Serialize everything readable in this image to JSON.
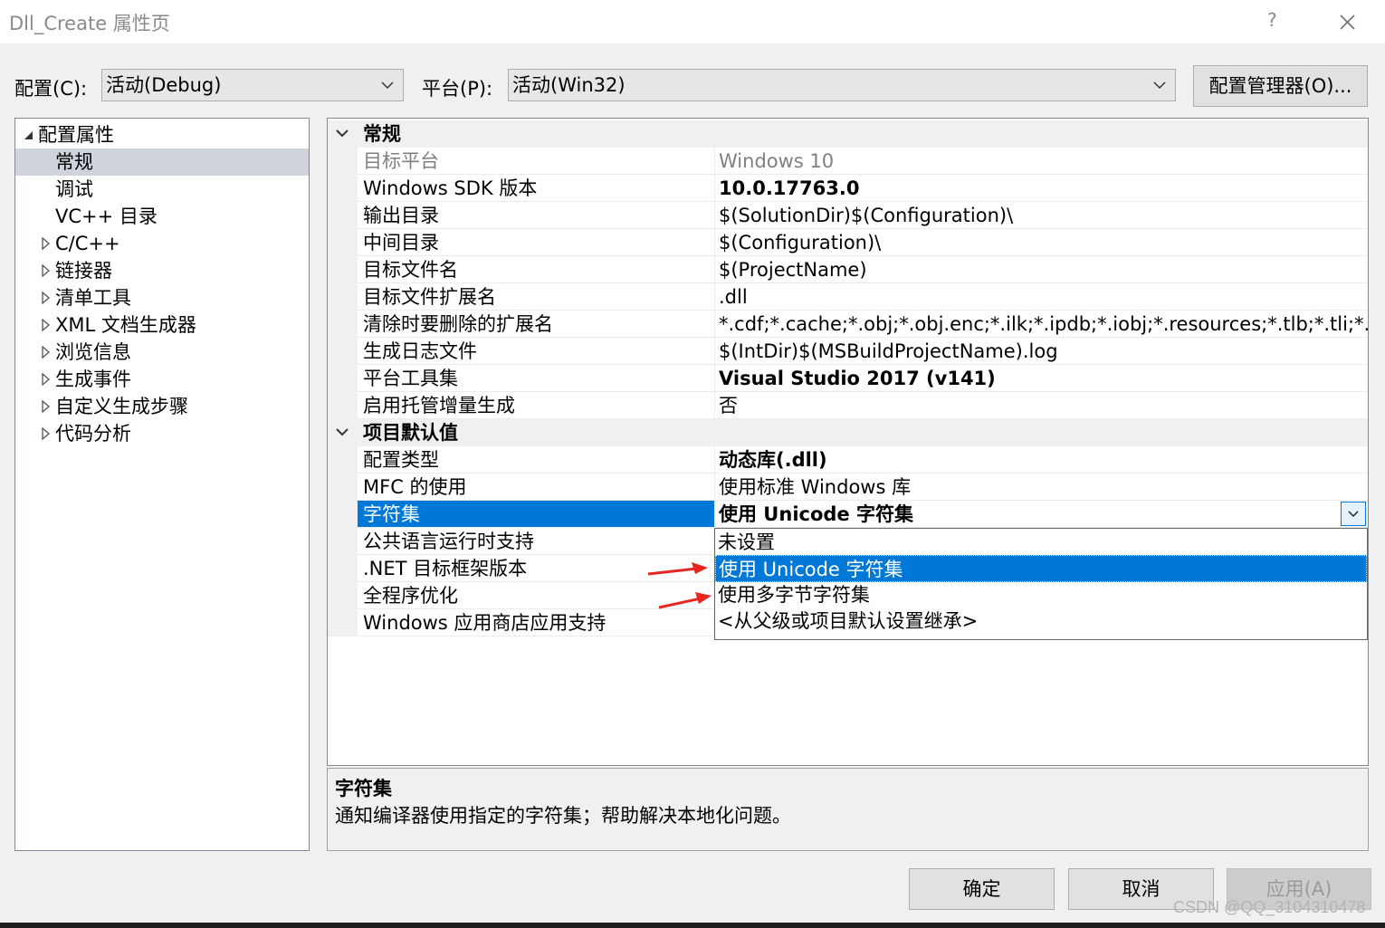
{
  "window": {
    "title": "Dll_Create 属性页",
    "help": "?"
  },
  "toolbar": {
    "config_label": "配置(C):",
    "config_value": "活动(Debug)",
    "platform_label": "平台(P):",
    "platform_value": "活动(Win32)",
    "config_manager_button": "配置管理器(O)..."
  },
  "tree": {
    "root": "配置属性",
    "items": [
      {
        "label": "常规",
        "expandable": false,
        "selected": true
      },
      {
        "label": "调试",
        "expandable": false
      },
      {
        "label": "VC++ 目录",
        "expandable": false
      },
      {
        "label": "C/C++",
        "expandable": true
      },
      {
        "label": "链接器",
        "expandable": true
      },
      {
        "label": "清单工具",
        "expandable": true
      },
      {
        "label": "XML 文档生成器",
        "expandable": true
      },
      {
        "label": "浏览信息",
        "expandable": true
      },
      {
        "label": "生成事件",
        "expandable": true
      },
      {
        "label": "自定义生成步骤",
        "expandable": true
      },
      {
        "label": "代码分析",
        "expandable": true
      }
    ]
  },
  "grid": {
    "categories": [
      {
        "label": "常规",
        "rows": [
          {
            "name": "目标平台",
            "value": "Windows 10",
            "style": "gray"
          },
          {
            "name": "Windows SDK 版本",
            "value": "10.0.17763.0",
            "style": "bold"
          },
          {
            "name": "输出目录",
            "value": "$(SolutionDir)$(Configuration)\\",
            "style": ""
          },
          {
            "name": "中间目录",
            "value": "$(Configuration)\\",
            "style": ""
          },
          {
            "name": "目标文件名",
            "value": "$(ProjectName)",
            "style": ""
          },
          {
            "name": "目标文件扩展名",
            "value": ".dll",
            "style": ""
          },
          {
            "name": "清除时要删除的扩展名",
            "value": "*.cdf;*.cache;*.obj;*.obj.enc;*.ilk;*.ipdb;*.iobj;*.resources;*.tlb;*.tli;*.tlh;*.t",
            "style": ""
          },
          {
            "name": "生成日志文件",
            "value": "$(IntDir)$(MSBuildProjectName).log",
            "style": ""
          },
          {
            "name": "平台工具集",
            "value": "Visual Studio 2017 (v141)",
            "style": "bold"
          },
          {
            "name": "启用托管增量生成",
            "value": "否",
            "style": ""
          }
        ]
      },
      {
        "label": "项目默认值",
        "rows": [
          {
            "name": "配置类型",
            "value": "动态库(.dll)",
            "style": "bold"
          },
          {
            "name": "MFC 的使用",
            "value": "使用标准 Windows 库",
            "style": ""
          },
          {
            "name": "字符集",
            "value": "使用 Unicode 字符集",
            "style": "bold",
            "selected": true
          },
          {
            "name": "公共语言运行时支持",
            "value": "",
            "style": ""
          },
          {
            "name": ".NET 目标框架版本",
            "value": "",
            "style": ""
          },
          {
            "name": "全程序优化",
            "value": "",
            "style": ""
          },
          {
            "name": "Windows 应用商店应用支持",
            "value": "",
            "style": ""
          }
        ]
      }
    ]
  },
  "dropdown": {
    "options": [
      "未设置",
      "使用 Unicode 字符集",
      "使用多字节字符集",
      "<从父级或项目默认设置继承>"
    ],
    "highlighted": "使用 Unicode 字符集"
  },
  "description": {
    "title": "字符集",
    "text": "通知编译器使用指定的字符集；帮助解决本地化问题。"
  },
  "buttons": {
    "ok": "确定",
    "cancel": "取消",
    "apply": "应用(A)"
  },
  "watermark": "CSDN @QQ_3104310478",
  "colors": {
    "selection": "#0078d7",
    "annotation_arrow": "#e8251f"
  }
}
